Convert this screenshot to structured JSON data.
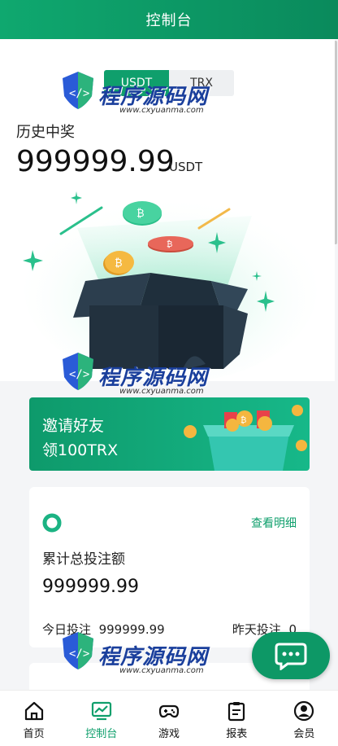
{
  "header": {
    "title": "控制台"
  },
  "currency_tabs": [
    {
      "label": "USDT",
      "active": true
    },
    {
      "label": "TRX",
      "active": false
    }
  ],
  "history": {
    "label": "历史中奖",
    "amount": "999999.99",
    "unit": "USDT"
  },
  "watermark": {
    "text": "程序源码网",
    "url": "www.cxyuanma.com"
  },
  "invite": {
    "line1": "邀请好友",
    "line2": "领100TRX"
  },
  "bet_card": {
    "detail_link": "查看明细",
    "title": "累计总投注额",
    "total": "999999.99",
    "today_label": "今日投注",
    "today_value": "999999.99",
    "yesterday_label": "昨天投注",
    "yesterday_value": "0"
  },
  "nav": [
    {
      "label": "首页",
      "icon": "home-icon",
      "active": false
    },
    {
      "label": "控制台",
      "icon": "dashboard-icon",
      "active": true
    },
    {
      "label": "游戏",
      "icon": "gamepad-icon",
      "active": false
    },
    {
      "label": "报表",
      "icon": "report-icon",
      "active": false
    },
    {
      "label": "会员",
      "icon": "user-icon",
      "active": false
    }
  ],
  "colors": {
    "accent": "#0f9f6c",
    "header": "#0a8a5c",
    "watermark": "#1a3f9c"
  }
}
